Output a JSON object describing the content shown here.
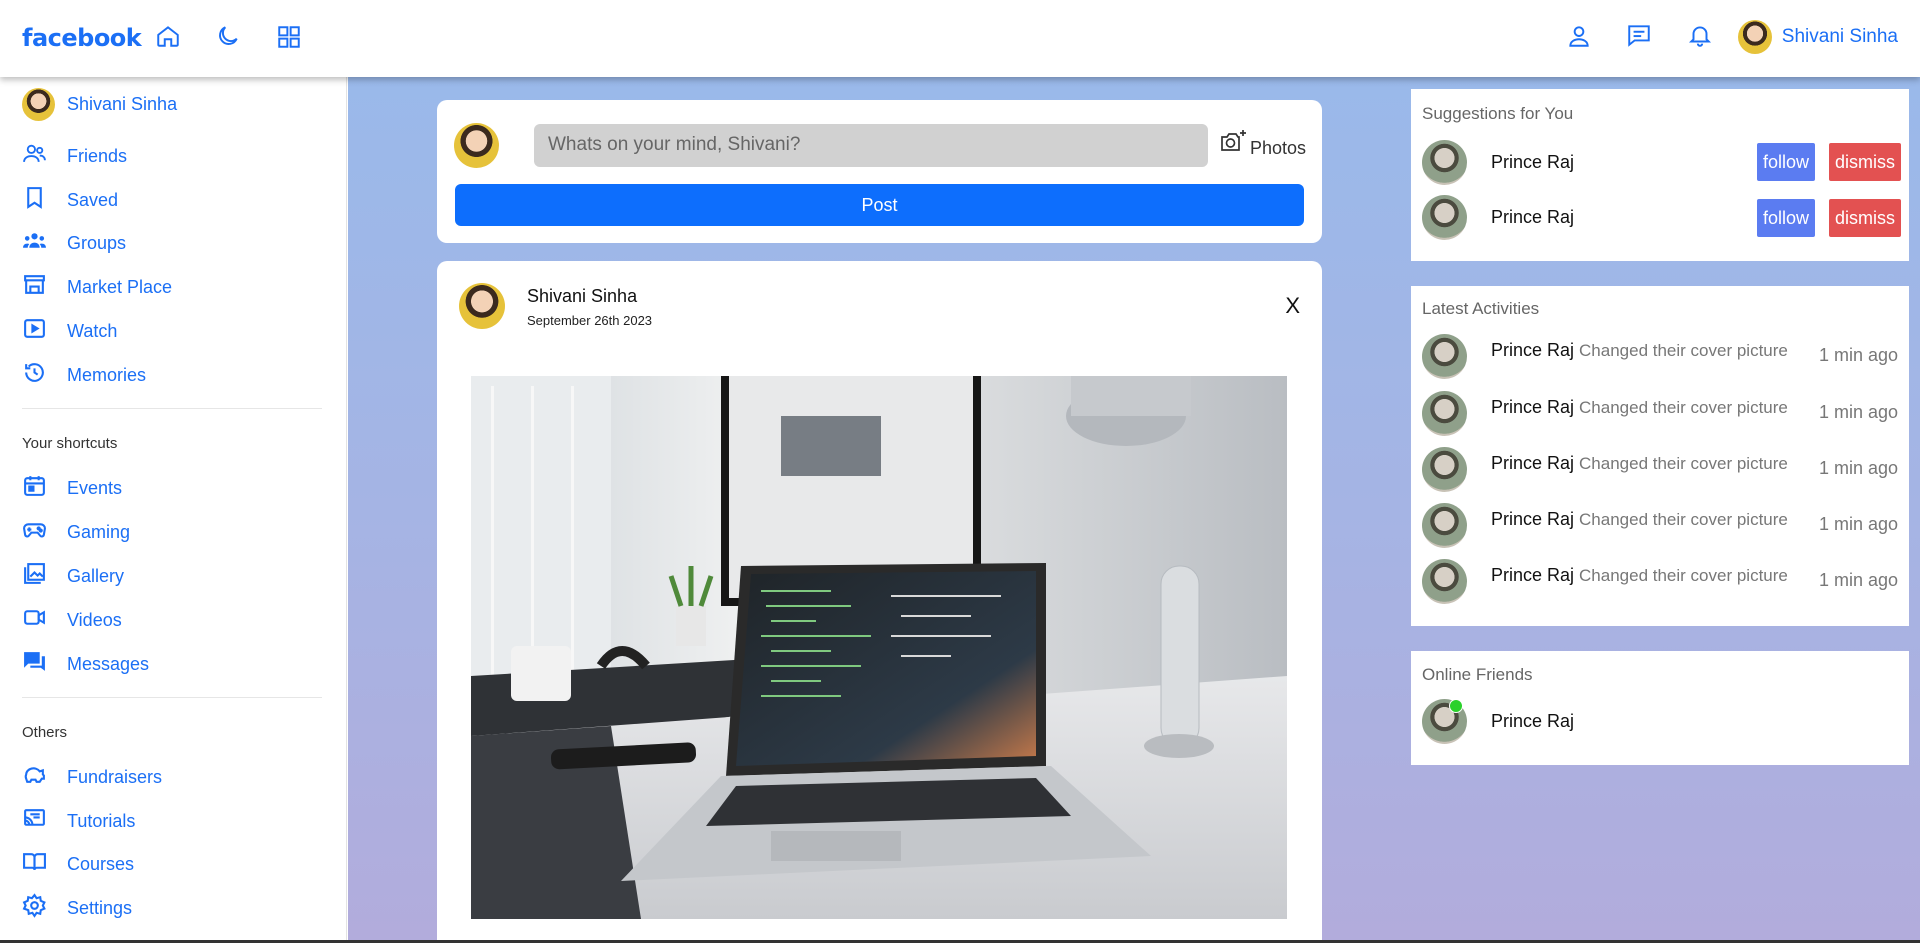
{
  "app": {
    "logo": "facebook"
  },
  "navbar": {
    "user_name": "Shivani Sinha",
    "icons": [
      "home-icon",
      "moon-icon",
      "grid-icon",
      "person-icon",
      "message-icon",
      "bell-icon"
    ]
  },
  "sidebar": {
    "profile_name": "Shivani Sinha",
    "main_items": [
      {
        "label": "Friends",
        "icon": "friends-icon"
      },
      {
        "label": "Saved",
        "icon": "bookmark-icon"
      },
      {
        "label": "Groups",
        "icon": "groups-icon"
      },
      {
        "label": "Market Place",
        "icon": "store-icon"
      },
      {
        "label": "Watch",
        "icon": "play-icon"
      },
      {
        "label": "Memories",
        "icon": "history-icon"
      }
    ],
    "shortcuts_title": "Your shortcuts",
    "shortcuts": [
      {
        "label": "Events",
        "icon": "calendar-icon"
      },
      {
        "label": "Gaming",
        "icon": "gamepad-icon"
      },
      {
        "label": "Gallery",
        "icon": "image-icon"
      },
      {
        "label": "Videos",
        "icon": "video-icon"
      },
      {
        "label": "Messages",
        "icon": "messages-icon"
      }
    ],
    "others_title": "Others",
    "others": [
      {
        "label": "Fundraisers",
        "icon": "piggybank-icon"
      },
      {
        "label": "Tutorials",
        "icon": "cast-icon"
      },
      {
        "label": "Courses",
        "icon": "book-icon"
      },
      {
        "label": "Settings",
        "icon": "gear-icon"
      }
    ]
  },
  "composer": {
    "placeholder": "Whats on your mind, Shivani?",
    "photos_label": "Photos",
    "post_label": "Post"
  },
  "post": {
    "author": "Shivani Sinha",
    "date": "September 26th 2023",
    "close_label": "X"
  },
  "suggestions": {
    "title": "Suggestions for You",
    "items": [
      {
        "name": "Prince Raj",
        "follow": "follow",
        "dismiss": "dismiss"
      },
      {
        "name": "Prince Raj",
        "follow": "follow",
        "dismiss": "dismiss"
      }
    ]
  },
  "activities": {
    "title": "Latest Activities",
    "items": [
      {
        "name": "Prince Raj",
        "text": "Changed their cover picture",
        "time": "1 min ago"
      },
      {
        "name": "Prince Raj",
        "text": "Changed their cover picture",
        "time": "1 min ago"
      },
      {
        "name": "Prince Raj",
        "text": "Changed their cover picture",
        "time": "1 min ago"
      },
      {
        "name": "Prince Raj",
        "text": "Changed their cover picture",
        "time": "1 min ago"
      },
      {
        "name": "Prince Raj",
        "text": "Changed their cover picture",
        "time": "1 min ago"
      }
    ]
  },
  "online": {
    "title": "Online Friends",
    "items": [
      {
        "name": "Prince Raj",
        "status": "online"
      }
    ]
  },
  "colors": {
    "accent": "#1b6ff5",
    "post_button": "#0d6efd",
    "follow": "#5b7cf1",
    "dismiss": "#e35151",
    "online": "#2bd12b"
  }
}
